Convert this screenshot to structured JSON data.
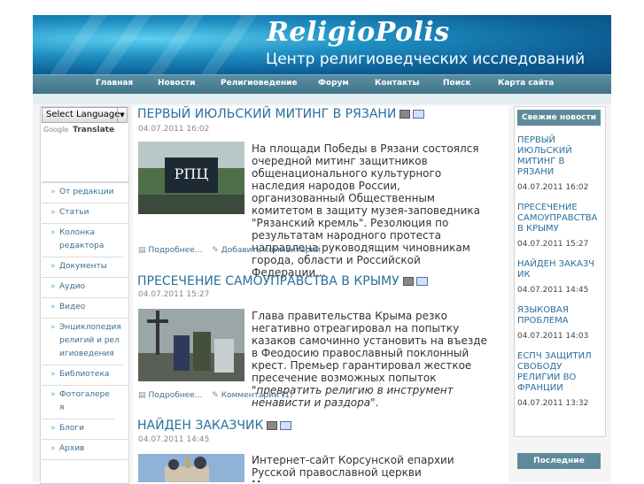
{
  "header": {
    "title": "ReligioPolis",
    "subtitle": "Центр религиоведческих исследований"
  },
  "nav": [
    {
      "label": "Главная"
    },
    {
      "label": "Новости"
    },
    {
      "label": "Религиоведение"
    },
    {
      "label": "Форум"
    },
    {
      "label": "Контакты"
    },
    {
      "label": "Поиск"
    },
    {
      "label": "Карта сайта"
    }
  ],
  "translate": {
    "select_label": "Select Language",
    "powered_by": "Google",
    "translate_label": "Translate"
  },
  "left_menu": [
    {
      "label": "От редакции"
    },
    {
      "label": "Статьи"
    },
    {
      "label": "Колонка редактора"
    },
    {
      "label": "Документы"
    },
    {
      "label": "Аудио"
    },
    {
      "label": "Видео"
    },
    {
      "label": "Энциклопедия религий и религиоведения"
    },
    {
      "label": "Библиотека"
    },
    {
      "label": "Фотогалерея"
    },
    {
      "label": "Блоги"
    },
    {
      "label": "Архив"
    }
  ],
  "articles": [
    {
      "title": "ПЕРВЫЙ ИЮЛЬСКИЙ МИТИНГ В РЯЗАНИ",
      "date": "04.07.2011 16:02",
      "text": "На площади Победы в Рязани состоялся очередной митинг защитников общенационального культурного наследия народов России, организованный Общественным комитетом в защиту музея-заповедника \"Рязанский кремль\". Резолюция по результатам народного протеста направлена руководящим чиновникам города, области и Российской Федерации...",
      "more": "Подробнее...",
      "comments": "Добавить комментарий",
      "image_caption": "РПЦ"
    },
    {
      "title": "ПРЕСЕЧЕНИЕ САМОУПРАВСТВА В КРЫМУ",
      "date": "04.07.2011 15:27",
      "text": "Глава правительства Крыма резко негативно отреагировал на попытку казаков самочинно установить на въезде в Феодосию православный поклонный крест. Премьер гарантировал жесткое пресечение возможных попыток ",
      "text_italic": "\"превратить религию в инструмент ненависти и раздора\"",
      "more": "Подробнее...",
      "comments": "Комментарии (1)"
    },
    {
      "title": "НАЙДЕН ЗАКАЗЧИК",
      "date": "04.07.2011 14:45",
      "text": "Интернет-сайт Корсунской епархии Русской православной церкви Московского патриархата распространил ложную"
    }
  ],
  "right_sidebar": {
    "header": "Свежие новости",
    "news": [
      {
        "title": "ПЕРВЫЙ ИЮЛЬСКИЙ МИТИНГ В РЯЗАНИ",
        "date": "04.07.2011 16:02"
      },
      {
        "title": "ПРЕСЕЧЕНИЕ САМОУПРАВСТВА В КРЫМУ",
        "date": "04.07.2011 15:27"
      },
      {
        "title": "НАЙДЕН ЗАКАЗЧИК",
        "date": "04.07.2011 14:45"
      },
      {
        "title": "ЯЗЫКОВАЯ ПРОБЛЕМА",
        "date": "04.07.2011 14:03"
      },
      {
        "title": "ЕСПЧ ЗАЩИТИЛ СВОБОДУ РЕЛИГИИ ВО ФРАНЦИИ",
        "date": "04.07.2011 13:32"
      }
    ],
    "header2": "Последние"
  },
  "colors": {
    "accent": "#2b6f9e",
    "nav": "#4a7f94"
  }
}
